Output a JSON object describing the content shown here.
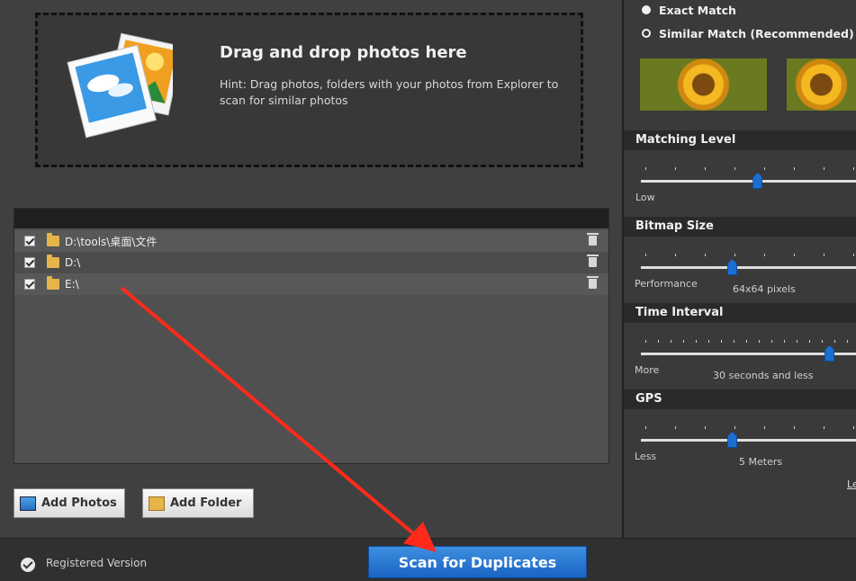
{
  "drop_zone": {
    "title": "Drag and drop photos here",
    "hint": "Hint: Drag photos, folders with your photos from Explorer to scan for similar photos"
  },
  "folders": [
    {
      "path": "D:\\tools\\桌面\\文件",
      "checked": true
    },
    {
      "path": "D:\\",
      "checked": true
    },
    {
      "path": "E:\\",
      "checked": true
    }
  ],
  "buttons": {
    "add_photos": "Add Photos",
    "add_folder": "Add Folder",
    "scan": "Scan for Duplicates"
  },
  "status": {
    "registered": "Registered Version"
  },
  "match_mode": {
    "exact": "Exact Match",
    "similar": "Similar Match (Recommended)",
    "selected": "exact"
  },
  "settings": {
    "matching_level": {
      "label": "Matching Level",
      "low_label": "Low",
      "value_fraction": 0.55
    },
    "bitmap_size": {
      "label": "Bitmap Size",
      "low_label": "Performance",
      "value": "64x64 pixels",
      "value_fraction": 0.43
    },
    "time_interval": {
      "label": "Time Interval",
      "low_label": "More",
      "value": "30 seconds and less",
      "value_fraction": 0.89
    },
    "gps": {
      "label": "GPS",
      "low_label": "Less",
      "value": "5 Meters",
      "value_fraction": 0.43
    }
  },
  "link_partial": "Le",
  "colors": {
    "accent": "#1a64c4",
    "annotation_arrow": "#ff2a1a"
  }
}
